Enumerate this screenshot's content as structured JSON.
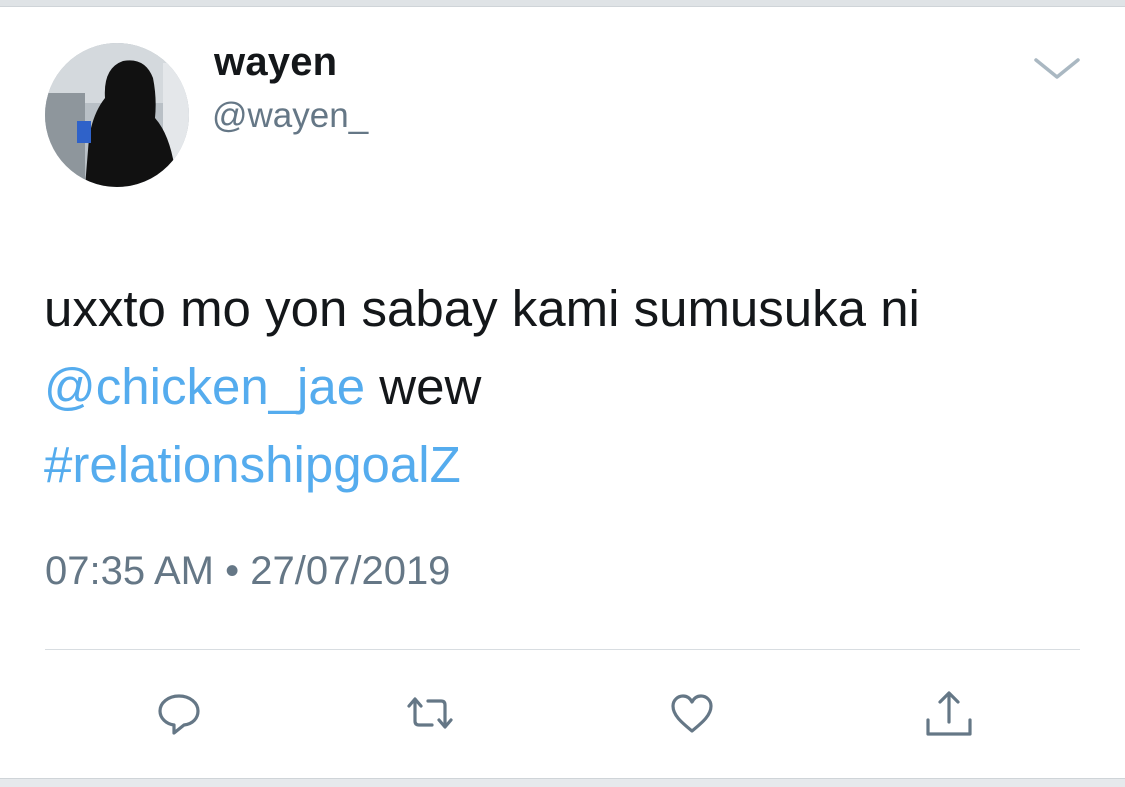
{
  "user": {
    "display_name": "wayen",
    "handle": "@wayen_"
  },
  "tweet": {
    "text_before_mention": "uxxto mo yon sabay kami sumusuka ni ",
    "mention": "@chicken_jae",
    "text_after_mention": " wew",
    "hashtag": "#relationshipgoalZ",
    "timestamp": "07:35 AM • 27/07/2019"
  },
  "icons": {
    "menu": "chevron-down-icon",
    "reply": "reply-icon",
    "retweet": "retweet-icon",
    "like": "heart-icon",
    "share": "share-icon"
  },
  "colors": {
    "link": "#55acee",
    "text": "#14171a",
    "secondary": "#657786",
    "icon": "#657786"
  }
}
